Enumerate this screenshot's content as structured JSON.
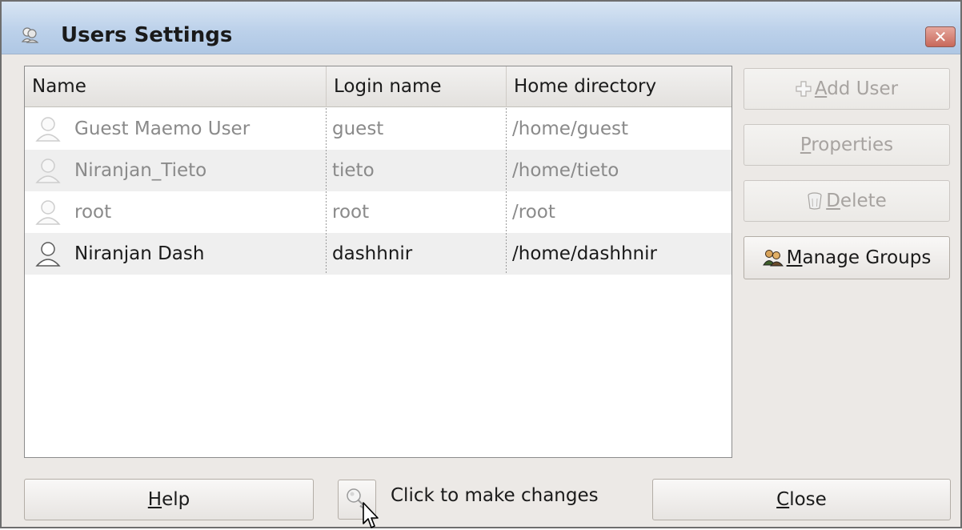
{
  "window": {
    "title": "Users Settings",
    "close_symbol": "✕",
    "title_icon": "users-icon"
  },
  "table": {
    "columns": [
      "Name",
      "Login name",
      "Home directory"
    ],
    "rows": [
      {
        "name": "Guest Maemo User",
        "login": "guest",
        "home": "/home/guest",
        "enabled": false
      },
      {
        "name": "Niranjan_Tieto",
        "login": "tieto",
        "home": "/home/tieto",
        "enabled": false
      },
      {
        "name": "root",
        "login": "root",
        "home": "/root",
        "enabled": false
      },
      {
        "name": "Niranjan Dash",
        "login": "dashhnir",
        "home": "/home/dashhnir",
        "enabled": true
      }
    ]
  },
  "side_buttons": {
    "add_user": {
      "prefix": "",
      "mnemonic": "A",
      "rest": "dd User",
      "icon": "plus-icon",
      "enabled": false
    },
    "properties": {
      "mnemonic": "P",
      "rest": "roperties",
      "enabled": false
    },
    "delete": {
      "mnemonic": "D",
      "rest": "elete",
      "icon": "trash-icon",
      "enabled": false
    },
    "manage_groups": {
      "mnemonic": "M",
      "rest": "anage Groups",
      "icon": "group-icon",
      "enabled": true
    }
  },
  "bottom": {
    "help": {
      "mnemonic": "H",
      "rest": "elp"
    },
    "lock_text": "Click to make changes",
    "lock_icon": "key-icon",
    "close": {
      "mnemonic": "C",
      "rest": "lose"
    }
  }
}
